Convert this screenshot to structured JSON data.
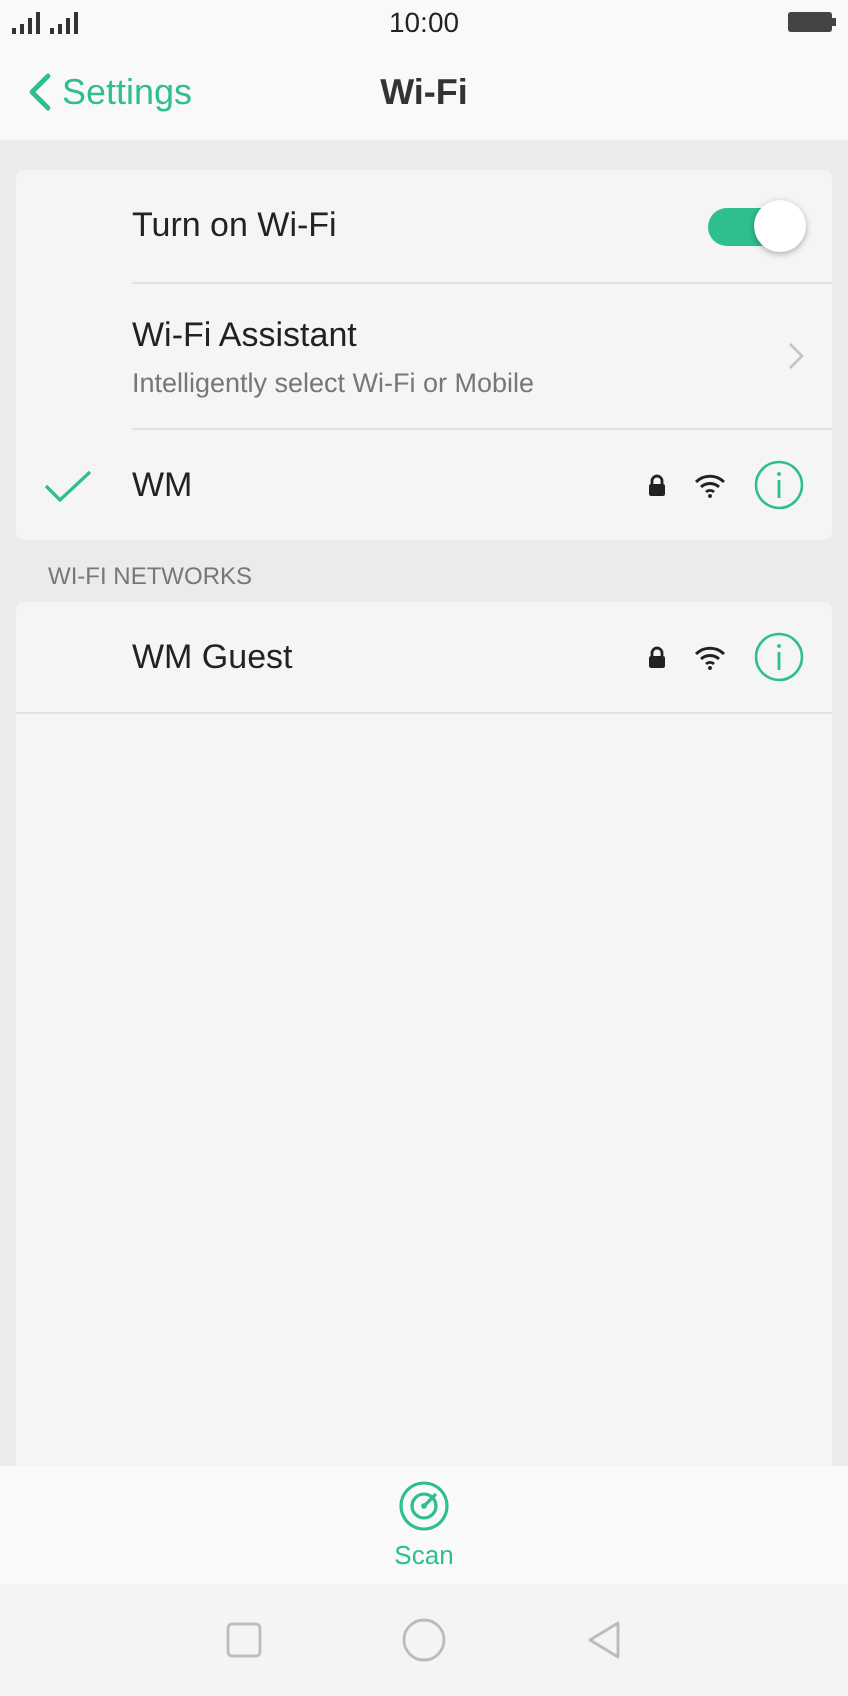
{
  "status_bar": {
    "time": "10:00"
  },
  "header": {
    "back_label": "Settings",
    "title": "Wi-Fi"
  },
  "wifi_toggle": {
    "label": "Turn on Wi-Fi",
    "on": true
  },
  "assistant": {
    "title": "Wi-Fi Assistant",
    "subtitle": "Intelligently select Wi-Fi or Mobile"
  },
  "connected_networks": [
    {
      "name": "WM",
      "connected": true,
      "locked": true
    }
  ],
  "section_header": "WI-FI NETWORKS",
  "networks": [
    {
      "name": "WM Guest",
      "connected": false,
      "locked": true
    }
  ],
  "scan_button": {
    "label": "Scan"
  }
}
